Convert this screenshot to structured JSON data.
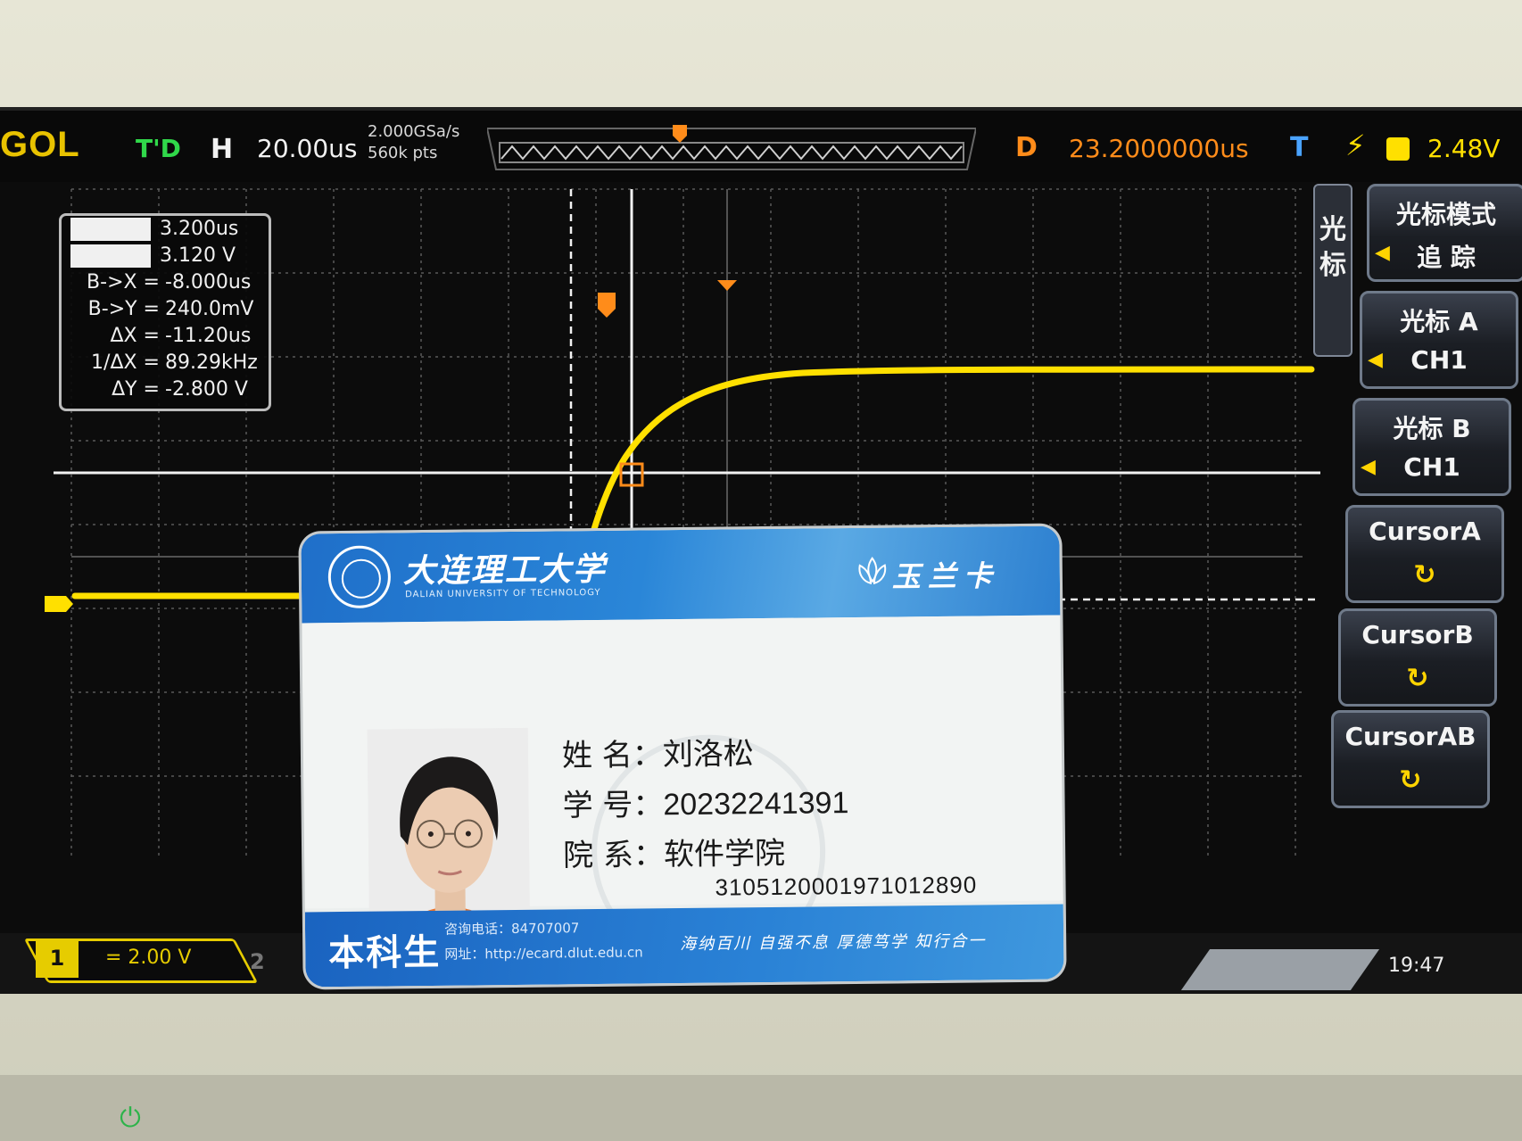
{
  "scope": {
    "brand": "GOL",
    "run_state": "T'D",
    "timebase_label": "H",
    "timebase": "20.00us",
    "sample_rate": "2.000GSa/s",
    "memory_depth": "560k pts",
    "delay_label": "D",
    "delay": "23.2000000us",
    "trigger_label": "T",
    "trigger_level": "2.48V",
    "colors": {
      "ch1": "#ffe000",
      "delay": "#ff8c1a",
      "trigger": "#4aa3ff"
    },
    "readout": {
      "rows": [
        {
          "key": "",
          "value": "3.200us",
          "masked": true
        },
        {
          "key": "",
          "value": "3.120 V",
          "masked": true
        },
        {
          "key": "B->X =",
          "value": "-8.000us"
        },
        {
          "key": "B->Y =",
          "value": "240.0mV"
        },
        {
          "key": "ΔX =",
          "value": "-11.20us"
        },
        {
          "key": "1/ΔX =",
          "value": "89.29kHz"
        },
        {
          "key": "ΔY =",
          "value": "-2.800 V"
        }
      ]
    },
    "ch1": {
      "number": "1",
      "scale": "=   2.00 V"
    },
    "ch2": {
      "number": "2"
    },
    "clock": "19:47",
    "menu": {
      "title": "光标",
      "items": [
        {
          "top": "光标模式",
          "bottom": "追  踪",
          "has_arrow": true
        },
        {
          "top": "光标 A",
          "bottom": "CH1",
          "has_arrow": true
        },
        {
          "top": "光标 B",
          "bottom": "CH1",
          "has_arrow": true
        },
        {
          "top": "CursorA",
          "bottom_icon": "rotate-knob-icon"
        },
        {
          "top": "CursorB",
          "bottom_icon": "rotate-knob-icon"
        },
        {
          "top": "CursorAB",
          "bottom_icon": "rotate-knob-icon"
        }
      ]
    }
  },
  "card": {
    "university": "大连理工大学",
    "university_en": "DALIAN UNIVERSITY OF TECHNOLOGY",
    "brand": "玉兰卡",
    "fields": [
      {
        "label": "姓  名：",
        "value": "刘洛松"
      },
      {
        "label": "学  号：",
        "value": "20232241391"
      },
      {
        "label": "院  系：",
        "value": "软件学院"
      }
    ],
    "card_number": "3105120001971012890",
    "type": "本科生",
    "phone": "咨询电话：84707007",
    "url": "网址：http://ecard.dlut.edu.cn",
    "motto": "海纳百川  自强不息  厚德笃学  知行合一",
    "colors": {
      "header": "#2a86d8",
      "footer": "#1a63c0"
    }
  }
}
